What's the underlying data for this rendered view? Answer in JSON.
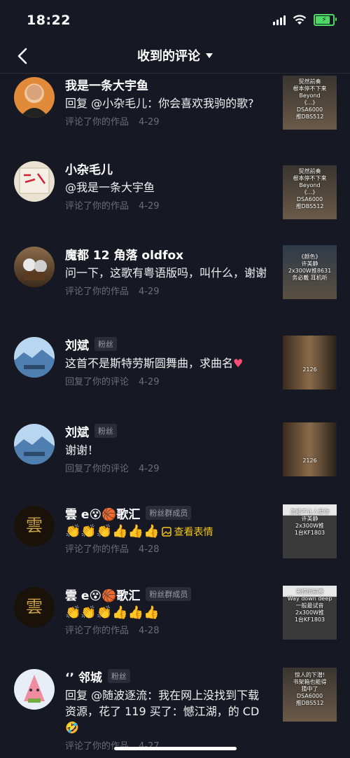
{
  "status_bar": {
    "time": "18:22"
  },
  "nav": {
    "title": "收到的评论"
  },
  "comments": [
    {
      "name": "我是一条大宇鱼",
      "badge": "",
      "text": "回复 @小杂毛儿：你会喜欢我驹的歌?",
      "action": "评论了你的作品",
      "date": "4-29",
      "thumb_lines": [
        "贸然前奏",
        "根本停不下来",
        "Beyond",
        "《...》",
        "DSA6000",
        "推DBS512"
      ]
    },
    {
      "name": "小杂毛儿",
      "badge": "",
      "text": "@我是一条大宇鱼",
      "action": "评论了你的作品",
      "date": "4-29",
      "thumb_lines": [
        "贸然前奏",
        "根本停不下来",
        "Beyond",
        "《...》",
        "DSA6000",
        "推DBS512"
      ]
    },
    {
      "name": "魔都 12 角落 oldfox",
      "badge": "",
      "text": "问一下，这歌有粤语版吗，叫什么，谢谢",
      "action": "评论了你的作品",
      "date": "4-29",
      "thumb_lines": [
        "《颜色》",
        "许美静",
        "2x300W推8631",
        "务必戴 耳机听"
      ]
    },
    {
      "name": "刘斌",
      "badge": "粉丝",
      "text": "这首不是斯特劳斯圆舞曲，求曲名",
      "action": "回复了你的评论",
      "date": "4-29",
      "thumb_lines": [
        "2126"
      ]
    },
    {
      "name": "刘斌",
      "badge": "粉丝",
      "text": "谢谢！",
      "action": "回复了你的评论",
      "date": "4-29",
      "thumb_lines": [
        "2126"
      ]
    },
    {
      "name": "雲",
      "badge": "粉丝群成员",
      "text": "",
      "action": "评论了你的作品",
      "date": "4-28",
      "extra": "查看表情",
      "thumb_lines": [
        "怎能不让人爱你",
        "许美静",
        "2x300W推",
        "1台KF1803"
      ]
    },
    {
      "name": "雲",
      "badge": "粉丝群成员",
      "text": "",
      "action": "评论了你的作品",
      "date": "4-28",
      "thumb_lines": [
        "沸腾版前奏",
        "Way down deep",
        "一般最试音",
        "2x300W推",
        "1台KF1803"
      ]
    },
    {
      "name": "邻城",
      "badge": "粉丝",
      "text": "回复 @随波逐流：我在网上没找到下载资源，花了 119 买了：憾江湖，的 CD",
      "action": "评论了你的作品",
      "date": "4-27",
      "thumb_lines": [
        "惊人的下潜!",
        "书架箱也能得",
        "猜中了",
        "DSA6000",
        "推DBS512"
      ]
    }
  ],
  "name_suffix": "歌汇"
}
